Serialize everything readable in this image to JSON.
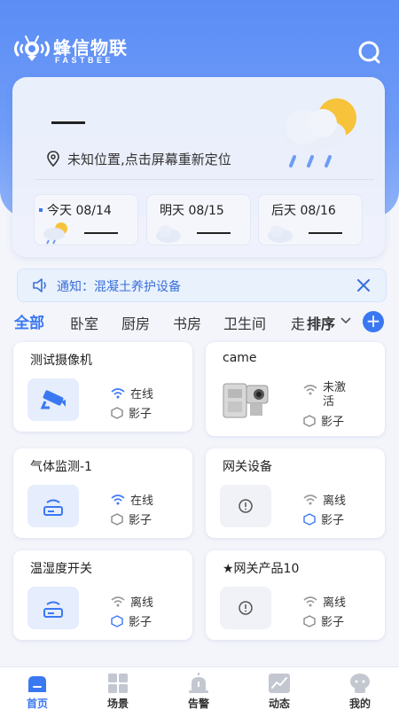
{
  "app": {
    "title": "蜂信物联",
    "subtitle": "FASTBEE"
  },
  "weather": {
    "location": "未知位置,点击屏幕重新定位",
    "days": [
      {
        "label": "今天 08/14"
      },
      {
        "label": "明天 08/15"
      },
      {
        "label": "后天 08/16"
      }
    ]
  },
  "notice": {
    "text": "通知：混凝土养护设备"
  },
  "tabs": [
    "全部",
    "卧室",
    "厨房",
    "书房",
    "卫生间",
    "走"
  ],
  "sort_label": "排序",
  "add_label": "+",
  "devices": [
    {
      "name": "测试摄像机",
      "net": "在线",
      "shadow": "影子",
      "icon": "camera-icon"
    },
    {
      "name": "came",
      "net": "未激活",
      "shadow": "影子",
      "icon": "device-photo"
    },
    {
      "name": "气体监测-1",
      "net": "在线",
      "shadow": "影子",
      "icon": "router-icon"
    },
    {
      "name": "网关设备",
      "net": "离线",
      "shadow": "影子",
      "icon": "info-icon"
    },
    {
      "name": "温湿度开关",
      "net": "离线",
      "shadow": "影子",
      "icon": "router-icon"
    },
    {
      "name": "★网关产品10",
      "net": "离线",
      "shadow": "影子",
      "icon": "info-icon"
    }
  ],
  "nav": [
    {
      "label": "首页"
    },
    {
      "label": "场景"
    },
    {
      "label": "告警"
    },
    {
      "label": "动态"
    },
    {
      "label": "我的"
    }
  ],
  "colors": {
    "primary": "#3a78f2",
    "online": "#3a78f2",
    "offline": "#8a8f99",
    "hero": "#5b8df6"
  }
}
